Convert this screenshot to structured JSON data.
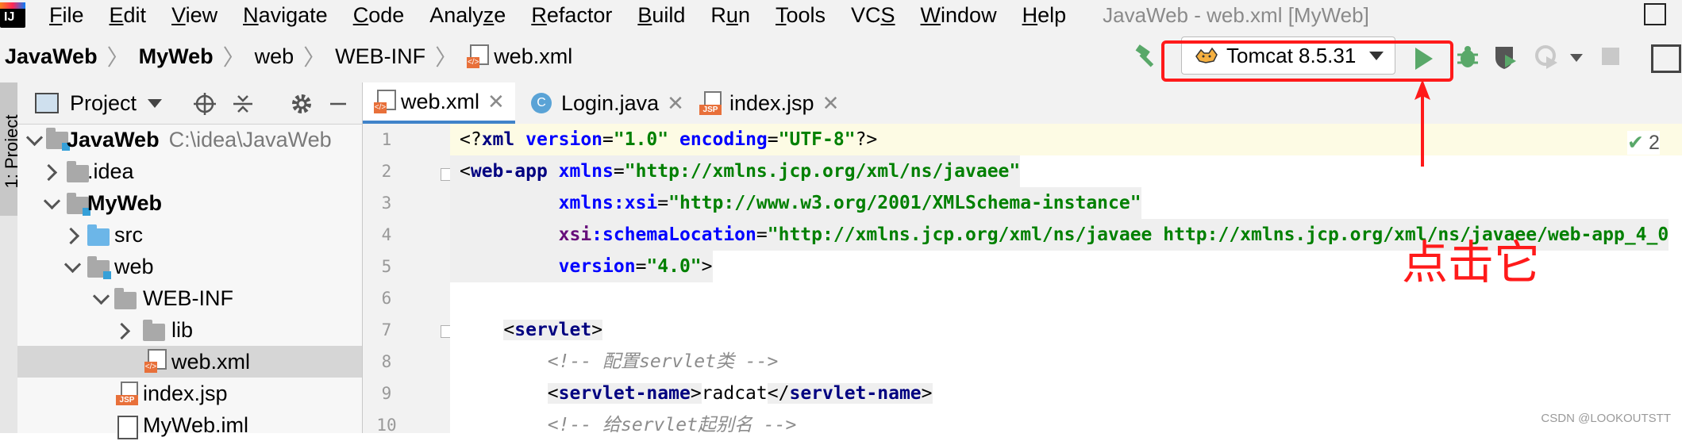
{
  "menu": {
    "logo_text": "IJ",
    "items": [
      "File",
      "Edit",
      "View",
      "Navigate",
      "Code",
      "Analyze",
      "Refactor",
      "Build",
      "Run",
      "Tools",
      "VCS",
      "Window",
      "Help"
    ],
    "mnemonics": [
      "F",
      "E",
      "V",
      "N",
      "C",
      "z",
      "R",
      "B",
      "u",
      "T",
      "S",
      "W",
      "H"
    ],
    "window_title": "JavaWeb - web.xml [MyWeb]"
  },
  "breadcrumb": {
    "items": [
      "JavaWeb",
      "MyWeb",
      "web",
      "WEB-INF",
      "web.xml"
    ]
  },
  "run_config": {
    "label": "Tomcat 8.5.31"
  },
  "project_panel": {
    "title": "Project",
    "side_tab_label": "1: Project",
    "tree": [
      {
        "label": "JavaWeb",
        "path": "C:\\idea\\JavaWeb"
      },
      {
        "label": ".idea"
      },
      {
        "label": "MyWeb"
      },
      {
        "label": "src"
      },
      {
        "label": "web"
      },
      {
        "label": "WEB-INF"
      },
      {
        "label": "lib"
      },
      {
        "label": "web.xml"
      },
      {
        "label": "index.jsp"
      },
      {
        "label": "MyWeb.iml"
      }
    ]
  },
  "tabs": [
    {
      "label": "web.xml",
      "active": true
    },
    {
      "label": "Login.java",
      "active": false
    },
    {
      "label": "index.jsp",
      "active": false
    }
  ],
  "editor": {
    "line_numbers": [
      "1",
      "2",
      "3",
      "4",
      "5",
      "6",
      "7",
      "8",
      "9",
      "10"
    ],
    "inspection_count": "2",
    "code": {
      "l1": {
        "a": "<?",
        "b": "xml",
        "c": " version",
        "d": "=",
        "e": "\"1.0\"",
        "f": " encoding",
        "g": "=",
        "h": "\"UTF-8\"",
        "i": "?>"
      },
      "l2": {
        "a": "<",
        "b": "web-app",
        "c": " xmlns",
        "d": "=",
        "e": "\"http://xmlns.jcp.org/xml/ns/javaee\""
      },
      "l3": {
        "indent": "         ",
        "a": "xmlns",
        "b": ":xsi",
        "c": "=",
        "d": "\"http://www.w3.org/2001/XMLSchema-instance\""
      },
      "l4": {
        "indent": "         ",
        "a": "xsi",
        "b": ":schemaLocation",
        "c": "=",
        "d": "\"http://xmlns.jcp.org/xml/ns/javaee http://xmlns.jcp.org/xml/ns/javaee/web-app_4_0"
      },
      "l5": {
        "indent": "         ",
        "a": "version",
        "b": "=",
        "c": "\"4.0\"",
        "d": ">"
      },
      "l7": {
        "indent": "    ",
        "a": "<",
        "b": "servlet",
        "c": ">"
      },
      "l8": {
        "indent": "        ",
        "a": "<!-- 配置servlet类 -->"
      },
      "l9": {
        "indent": "        ",
        "a": "<",
        "b": "servlet-name",
        "c": ">",
        "d": "radcat",
        "e": "</",
        "f": "servlet-name",
        "g": ">"
      },
      "l10": {
        "indent": "        ",
        "a": "<!-- 给servlet起别名 -->"
      }
    }
  },
  "annotation": {
    "note_text": "点击它",
    "color": "#ff1a1a"
  },
  "watermark": "CSDN @LOOKOUTSTT"
}
